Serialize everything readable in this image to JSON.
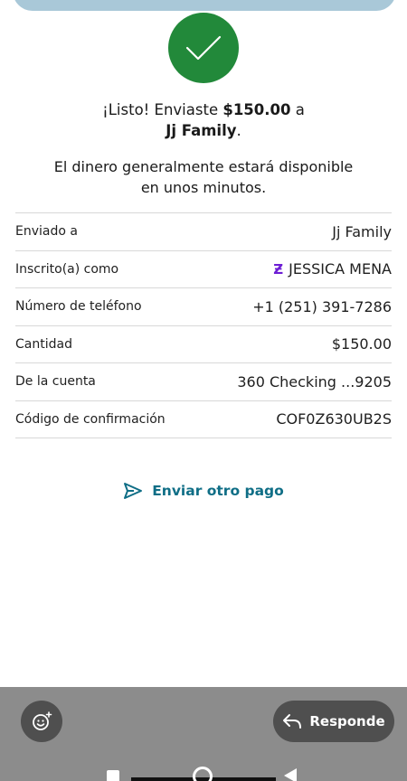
{
  "confirmation": {
    "headline_prefix": "¡Listo! Enviaste ",
    "amount": "$150.00",
    "headline_mid": " a",
    "recipient": "Jj Family",
    "headline_end": ".",
    "subtext_line1": "El dinero generalmente estará disponible",
    "subtext_line2": "en unos minutos.",
    "success_icon": "checkmark-icon",
    "success_color": "#22893a"
  },
  "details": [
    {
      "label": "Enviado a",
      "value": "Jj Family"
    },
    {
      "label": "Inscrito(a) como",
      "value": "JESSICA MENA",
      "icon": "zelle-icon"
    },
    {
      "label": "Número de teléfono",
      "value": "+1 (251) 391-7286"
    },
    {
      "label": "Cantidad",
      "value": "$150.00"
    },
    {
      "label": "De la cuenta",
      "value": "360 Checking ...9205"
    },
    {
      "label": "Código de confirmación",
      "value": "COF0Z630UB2S"
    }
  ],
  "actions": {
    "send_again_label": "Enviar otro pago",
    "send_again_icon": "send-icon",
    "accent_color": "#0f6e86"
  },
  "bottom_bar": {
    "emoji_icon": "emoji-add-icon",
    "reply_label": "Responde",
    "reply_icon": "reply-arrow-icon"
  }
}
